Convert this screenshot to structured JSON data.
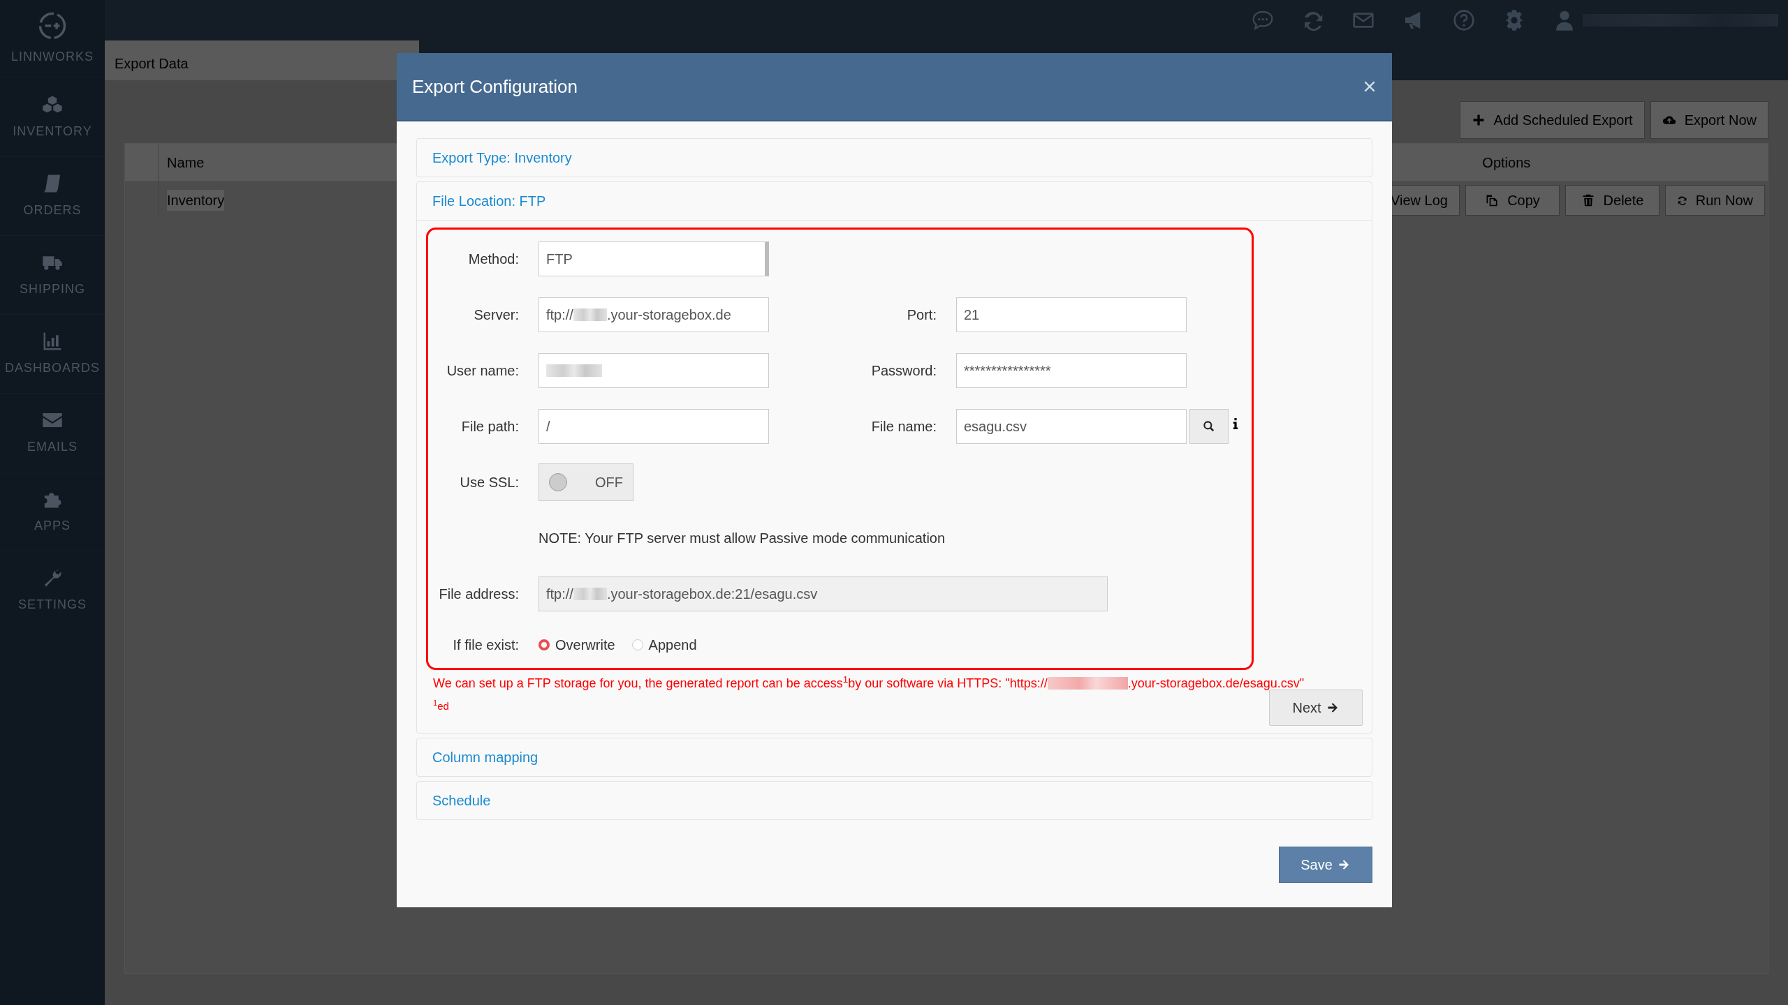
{
  "sidebar": {
    "logo": "LINNWORKS",
    "items": [
      {
        "label": "INVENTORY",
        "kind": "cubes"
      },
      {
        "label": "ORDERS",
        "kind": "book"
      },
      {
        "label": "SHIPPING",
        "kind": "truck"
      },
      {
        "label": "DASHBOARDS",
        "kind": "chart"
      },
      {
        "label": "EMAILS",
        "kind": "envelope"
      },
      {
        "label": "APPS",
        "kind": "puzzle"
      },
      {
        "label": "SETTINGS",
        "kind": "wrench"
      }
    ]
  },
  "page_tab": {
    "title": "Export Data"
  },
  "toolbar": [
    {
      "label": "Add Scheduled Export",
      "kind": "plus"
    },
    {
      "label": "Export Now",
      "kind": "cloud"
    }
  ],
  "table": {
    "columns": [
      "Name",
      "Options"
    ],
    "rows": [
      {
        "name": "Inventory",
        "actions": [
          {
            "label": "View Log",
            "kind": "text"
          },
          {
            "label": "Copy",
            "kind": "copy"
          },
          {
            "label": "Delete",
            "kind": "trash"
          },
          {
            "label": "Run Now",
            "kind": "refresh"
          }
        ]
      }
    ]
  },
  "modal": {
    "title": "Export Configuration",
    "sections": [
      {
        "title": "Export Type: Inventory",
        "expanded": false
      },
      {
        "title": "File Location: FTP",
        "expanded": true
      },
      {
        "title": "Column mapping",
        "expanded": false
      },
      {
        "title": "Schedule",
        "expanded": false
      }
    ],
    "form": {
      "method": {
        "label": "Method:",
        "value": "FTP"
      },
      "server": {
        "label": "Server:",
        "value": "ftp://",
        "value_after": ".your-storagebox.de",
        "redacted": true
      },
      "port": {
        "label": "Port:",
        "value": "21"
      },
      "user_name": {
        "label": "User name:",
        "redacted": true
      },
      "password": {
        "label": "Password:",
        "value": "****************"
      },
      "file_path": {
        "label": "File path:",
        "value": "/"
      },
      "file_name": {
        "label": "File name:",
        "value": "esagu.csv"
      },
      "use_ssl": {
        "label": "Use SSL:",
        "on": false,
        "state_text": "OFF"
      },
      "note": "NOTE: Your FTP server must allow Passive mode communication",
      "file_address": {
        "label": "File address:",
        "value": "ftp://",
        "value_after": ".your-storagebox.de:21/esagu.csv",
        "redacted": true
      },
      "if_file_exist": {
        "label": "If file exist:",
        "options": [
          {
            "label": "Overwrite",
            "selected": true
          },
          {
            "label": "Append",
            "selected": false
          }
        ]
      }
    },
    "annotation": {
      "text": "We can set up a FTP storage for you, the generated report can be access$^{1}$by our software via HTTPS: \"https://",
      "text_after": ".your-storagebox.de/esagu.csv\"",
      "redacted": true,
      "footnote": "$^{1}$ed"
    },
    "next_button": "Next",
    "save_button": "Save"
  }
}
